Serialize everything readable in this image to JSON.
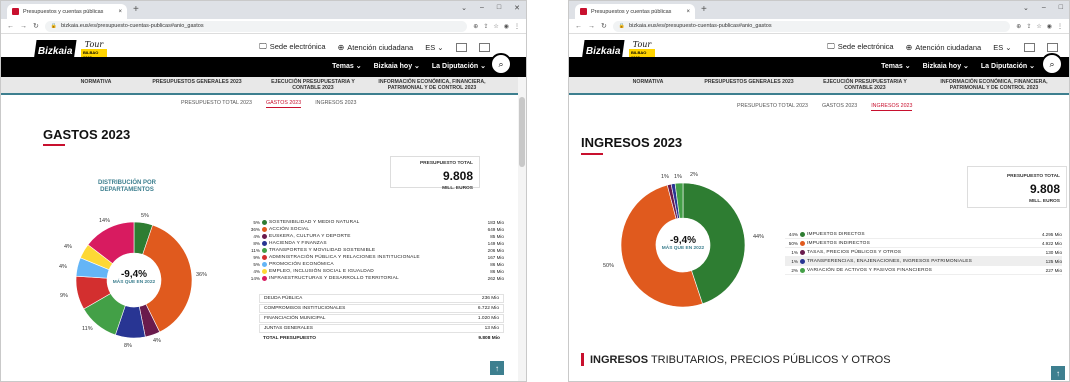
{
  "browser": {
    "tab_title": "Presupuestos y cuentas públicas",
    "tab_close": "×",
    "new_tab": "+",
    "url_left": "bizkaia.eus/es/presupuesto-cuentas-publicas#anio_gastos",
    "url_right": "bizkaia.eus/es/presupuesto-cuentas-publicas#anio_gastos",
    "window_controls": [
      "⌄",
      "–",
      "□",
      "✕"
    ]
  },
  "header": {
    "logo_text": "Bizkaia",
    "logo_sub": "foru aldundia · diputación foral",
    "tour_text": "Tour",
    "tour_badge": "BILBAO 2023",
    "sede": "Sede electrónica",
    "atencion": "Atención ciudadana",
    "lang": "ES ⌄",
    "menu": [
      "Temas ⌄",
      "Bizkaia hoy ⌄",
      "La Diputación ⌄"
    ],
    "search_icon": "⌕"
  },
  "nav": [
    "NORMATIVA",
    "PRESUPUESTOS GENERALES 2023",
    "EJECUCIÓN PRESUPUESTARIA Y CONTABLE 2023",
    "INFORMACIÓN ECONÓMICA, FINANCIERA, PATRIMONIAL Y DE CONTROL 2023"
  ],
  "subnav": [
    "PRESUPUESTO TOTAL 2023",
    "GASTOS 2023",
    "INGRESOS 2023"
  ],
  "left": {
    "title": "GASTOS 2023",
    "total_label": "PRESUPUESTO TOTAL",
    "total_value": "9.808",
    "total_unit": "MILL. EUROS",
    "dist_title": "DISTRIBUCIÓN POR DEPARTAMENTOS",
    "center_value": "-9,4%",
    "center_sub": "MÁS QUE EN 2022",
    "slice_labels": [
      "5%",
      "36%",
      "4%",
      "8%",
      "11%",
      "9%",
      "4%",
      "4%",
      "14%"
    ],
    "legend": [
      {
        "p": "5%",
        "name": "SOSTENIBILIDAD Y MEDIO NATURAL",
        "amount": "183 Mio",
        "color": "#2e7d32"
      },
      {
        "p": "36%",
        "name": "ACCIÓN SOCIAL",
        "amount": "649 Mio",
        "color": "#e05a1e"
      },
      {
        "p": "4%",
        "name": "EUSKERA, CULTURA Y DEPORTE",
        "amount": "85 Mio",
        "color": "#6a1b4d"
      },
      {
        "p": "8%",
        "name": "HACIENDA Y FINANZAS",
        "amount": "149 Mio",
        "color": "#283593"
      },
      {
        "p": "11%",
        "name": "TRANSPORTES Y MOVILIDAD SOSTENIBLE",
        "amount": "206 Mio",
        "color": "#43a047"
      },
      {
        "p": "9%",
        "name": "ADMINISTRACIÓN PÚBLICA Y RELACIONES INSTITUCIONALE",
        "amount": "167 Mio",
        "color": "#d32f2f"
      },
      {
        "p": "5%",
        "name": "PROMOCIÓN ECONÓMICA",
        "amount": "86 Mio",
        "color": "#64b5f6"
      },
      {
        "p": "4%",
        "name": "EMPLEO, INCLUSIÓN SOCIAL E IGUALDAD",
        "amount": "86 Mio",
        "color": "#fdd835"
      },
      {
        "p": "14%",
        "name": "INFRAESTRUCTURAS Y DESARROLLO TERRITORIAL",
        "amount": "262 Mio",
        "color": "#d81b60"
      }
    ],
    "table": [
      {
        "name": "DEUDA PÚBLICA",
        "amount": "236 Mio"
      },
      {
        "name": "COMPROMISOS INSTITUCIONALES",
        "amount": "6.722 Mio"
      },
      {
        "name": "FINANCIACIÓN MUNICIPAL",
        "amount": "1.020 Mio"
      },
      {
        "name": "JUNTAS GENERALES",
        "amount": "13 Mio"
      }
    ],
    "total_row": {
      "name": "TOTAL PRESUPUESTO",
      "amount": "9.808 Mio"
    }
  },
  "right": {
    "title": "INGRESOS 2023",
    "total_label": "PRESUPUESTO TOTAL",
    "total_value": "9.808",
    "total_unit": "MILL. EUROS",
    "center_value": "-9,4%",
    "center_sub": "MÁS QUE EN 2022",
    "slice_labels": [
      "1%",
      "1%",
      "2%",
      "44%",
      "50%"
    ],
    "legend": [
      {
        "p": "44%",
        "name": "IMPUESTOS DIRECTOS",
        "amount": "4.295 Mio",
        "color": "#2e7d32"
      },
      {
        "p": "50%",
        "name": "IMPUESTOS INDIRECTOS",
        "amount": "4.922 Mio",
        "color": "#e05a1e"
      },
      {
        "p": "1%",
        "name": "TASAS, PRECIOS PÚBLICOS Y OTROS",
        "amount": "130 Mio",
        "color": "#6a1b4d"
      },
      {
        "p": "1%",
        "name": "TRANSFERENCIAS, ENAJENACIONES, INGRESOS PATRIMONIALES",
        "amount": "125 Mio",
        "color": "#283593"
      },
      {
        "p": "2%",
        "name": "VARIACIÓN DE ACTIVOS Y PASIVOS FINANCIEROS",
        "amount": "227 Mio",
        "color": "#43a047"
      }
    ],
    "bottom_bold": "INGRESOS",
    "bottom_rest": "TRIBUTARIOS, PRECIOS PÚBLICOS Y OTROS"
  },
  "to_top": "↑",
  "chart_data": [
    {
      "type": "pie",
      "title": "DISTRIBUCIÓN POR DEPARTAMENTOS",
      "categories": [
        "SOSTENIBILIDAD Y MEDIO NATURAL",
        "ACCIÓN SOCIAL",
        "EUSKERA, CULTURA Y DEPORTE",
        "HACIENDA Y FINANZAS",
        "TRANSPORTES Y MOVILIDAD SOSTENIBLE",
        "ADMINISTRACIÓN PÚBLICA Y RELACIONES INSTITUCIONALE",
        "PROMOCIÓN ECONÓMICA",
        "EMPLEO, INCLUSIÓN SOCIAL E IGUALDAD",
        "INFRAESTRUCTURAS Y DESARROLLO TERRITORIAL"
      ],
      "values": [
        5,
        36,
        4,
        8,
        11,
        9,
        5,
        4,
        14
      ],
      "colors": [
        "#2e7d32",
        "#e05a1e",
        "#6a1b4d",
        "#283593",
        "#43a047",
        "#d32f2f",
        "#64b5f6",
        "#fdd835",
        "#d81b60"
      ]
    },
    {
      "type": "pie",
      "categories": [
        "IMPUESTOS DIRECTOS",
        "IMPUESTOS INDIRECTOS",
        "TASAS, PRECIOS PÚBLICOS Y OTROS",
        "TRANSFERENCIAS, ENAJENACIONES, INGRESOS PATRIMONIALES",
        "VARIACIÓN DE ACTIVOS Y PASIVOS FINANCIEROS"
      ],
      "values": [
        44,
        50,
        1,
        1,
        2
      ],
      "colors": [
        "#2e7d32",
        "#e05a1e",
        "#6a1b4d",
        "#283593",
        "#43a047"
      ]
    }
  ]
}
